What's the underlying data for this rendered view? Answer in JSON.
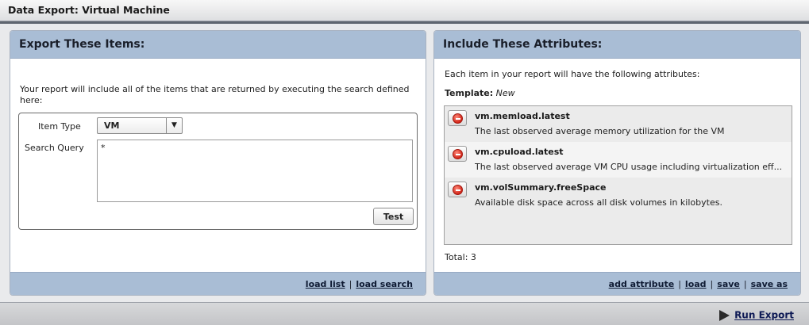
{
  "window": {
    "title": "Data Export: Virtual Machine"
  },
  "left_panel": {
    "title": "Export These Items:",
    "intro": "Your report will include all of the items that are returned by executing the search defined here:",
    "item_type_label": "Item Type",
    "item_type_value": "VM",
    "search_query_label": "Search Query",
    "search_query_value": "*",
    "test_button": "Test",
    "footer_links": {
      "load_list": "load list",
      "load_search": "load search",
      "separator": "|"
    }
  },
  "right_panel": {
    "title": "Include These Attributes:",
    "intro": "Each item in your report will have the following attributes:",
    "template_label": "Template:",
    "template_value": "New",
    "attributes": [
      {
        "name": "vm.memload.latest",
        "description": "The last observed average memory utilization for the VM"
      },
      {
        "name": "vm.cpuload.latest",
        "description": "The last observed average VM CPU usage including virtualization eff..."
      },
      {
        "name": "vm.volSummary.freeSpace",
        "description": "Available disk space across all disk volumes in kilobytes."
      }
    ],
    "total_label": "Total:",
    "total_value": "3",
    "footer_links": {
      "add_attribute": "add attribute",
      "load": "load",
      "save": "save",
      "save_as": "save as",
      "separator": "|"
    }
  },
  "footer": {
    "run_export": "Run Export"
  },
  "colors": {
    "panel_header": "#a9bdd5",
    "remove_icon": "#d2261a",
    "link": "#0e1a33"
  }
}
